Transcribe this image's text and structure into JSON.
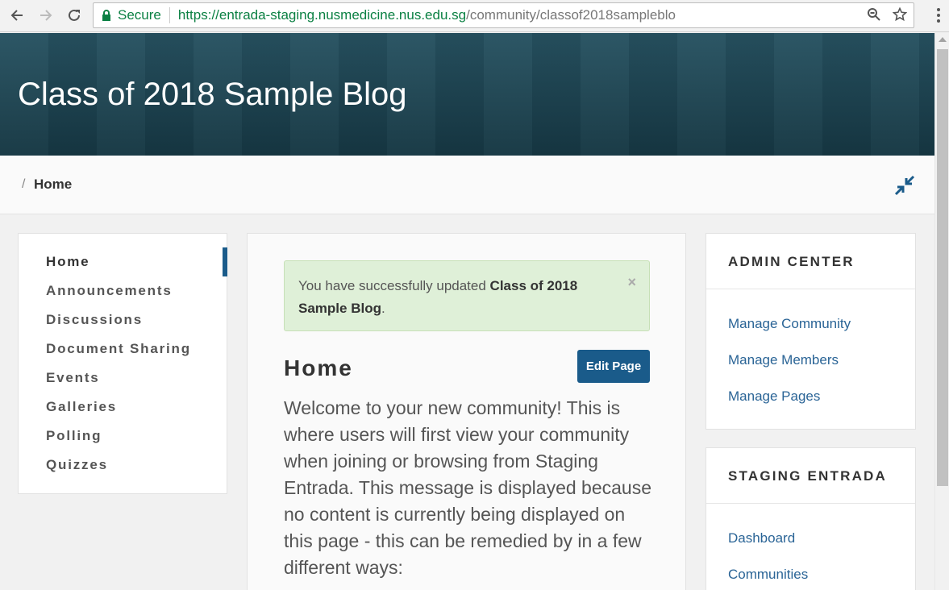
{
  "browser": {
    "secure_label": "Secure",
    "url_host": "https://entrada-staging.nusmedicine.nus.edu.sg",
    "url_path": "/community/classof2018sampleblo"
  },
  "banner": {
    "title": "Class of 2018 Sample Blog"
  },
  "breadcrumb": {
    "separator": "/",
    "current": "Home"
  },
  "leftnav": {
    "items": [
      {
        "label": "Home"
      },
      {
        "label": "Announcements"
      },
      {
        "label": "Discussions"
      },
      {
        "label": "Document Sharing"
      },
      {
        "label": "Events"
      },
      {
        "label": "Galleries"
      },
      {
        "label": "Polling"
      },
      {
        "label": "Quizzes"
      }
    ]
  },
  "main": {
    "alert": {
      "prefix": "You have successfully updated ",
      "bold": "Class of 2018 Sample Blog",
      "suffix": ".",
      "close": "×"
    },
    "heading": "Home",
    "edit_button": "Edit Page",
    "welcome": "Welcome to your new community! This is where users will first view your community when joining or browsing from Staging Entrada. This message is displayed because no content is currently being displayed on this page - this can be remedied by in a few different ways:"
  },
  "admin_center": {
    "title": "ADMIN CENTER",
    "links": [
      "Manage Community",
      "Manage Members",
      "Manage Pages"
    ]
  },
  "staging_entrada": {
    "title": "STAGING ENTRADA",
    "links": [
      "Dashboard",
      "Communities"
    ]
  },
  "colors": {
    "accent": "#1a5b8a",
    "link": "#2a6496",
    "banner": "#1d4a5a",
    "success_bg": "#dff0d8"
  }
}
